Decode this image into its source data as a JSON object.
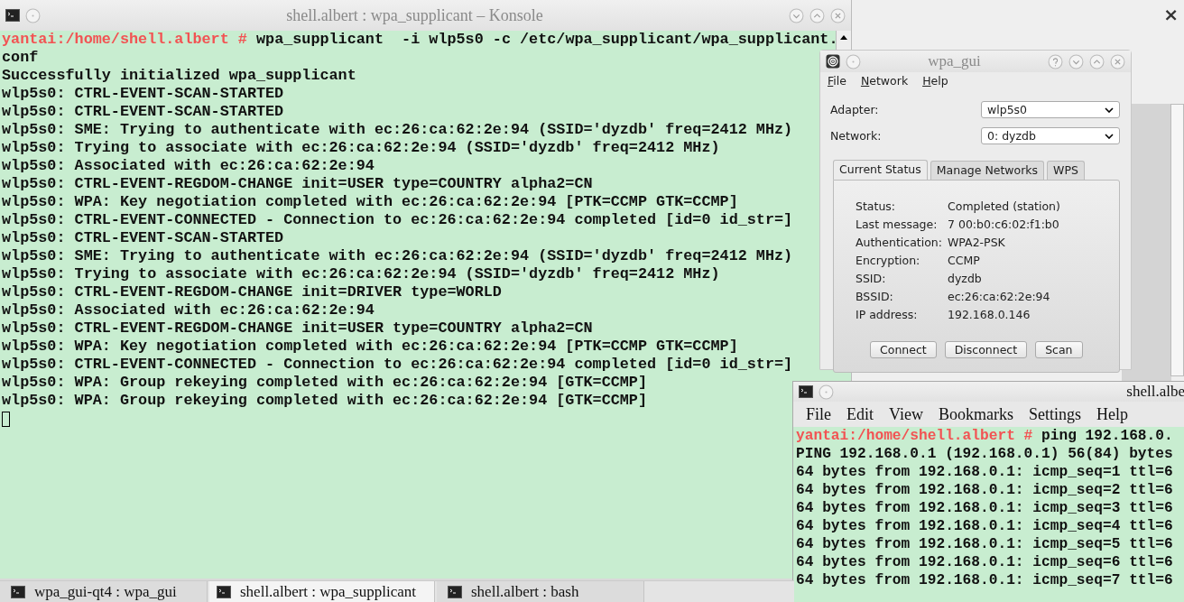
{
  "background_window": {
    "close_button": "×"
  },
  "main_konsole": {
    "title": "shell.albert : wpa_supplicant – Konsole",
    "prompt": "yantai:/home/shell.albert #",
    "command": "wpa_supplicant  -i wlp5s0 -c /etc/wpa_supplicant/wpa_supplicant.",
    "output": [
      "conf",
      "Successfully initialized wpa_supplicant",
      "wlp5s0: CTRL-EVENT-SCAN-STARTED",
      "wlp5s0: CTRL-EVENT-SCAN-STARTED",
      "wlp5s0: SME: Trying to authenticate with ec:26:ca:62:2e:94 (SSID='dyzdb' freq=2412 MHz)",
      "wlp5s0: Trying to associate with ec:26:ca:62:2e:94 (SSID='dyzdb' freq=2412 MHz)",
      "wlp5s0: Associated with ec:26:ca:62:2e:94",
      "wlp5s0: CTRL-EVENT-REGDOM-CHANGE init=USER type=COUNTRY alpha2=CN",
      "wlp5s0: WPA: Key negotiation completed with ec:26:ca:62:2e:94 [PTK=CCMP GTK=CCMP]",
      "wlp5s0: CTRL-EVENT-CONNECTED - Connection to ec:26:ca:62:2e:94 completed [id=0 id_str=]",
      "wlp5s0: CTRL-EVENT-SCAN-STARTED",
      "wlp5s0: SME: Trying to authenticate with ec:26:ca:62:2e:94 (SSID='dyzdb' freq=2412 MHz)",
      "wlp5s0: Trying to associate with ec:26:ca:62:2e:94 (SSID='dyzdb' freq=2412 MHz)",
      "wlp5s0: CTRL-EVENT-REGDOM-CHANGE init=DRIVER type=WORLD",
      "wlp5s0: Associated with ec:26:ca:62:2e:94",
      "wlp5s0: CTRL-EVENT-REGDOM-CHANGE init=USER type=COUNTRY alpha2=CN",
      "wlp5s0: WPA: Key negotiation completed with ec:26:ca:62:2e:94 [PTK=CCMP GTK=CCMP]",
      "wlp5s0: CTRL-EVENT-CONNECTED - Connection to ec:26:ca:62:2e:94 completed [id=0 id_str=]",
      "wlp5s0: WPA: Group rekeying completed with ec:26:ca:62:2e:94 [GTK=CCMP]",
      "wlp5s0: WPA: Group rekeying completed with ec:26:ca:62:2e:94 [GTK=CCMP]"
    ]
  },
  "wpa_gui": {
    "title": "wpa_gui",
    "menu": [
      "File",
      "Network",
      "Help"
    ],
    "fields": [
      {
        "label": "Adapter:",
        "value": "wlp5s0"
      },
      {
        "label": "Network:",
        "value": "0: dyzdb"
      }
    ],
    "tabs": [
      {
        "label": "Current Status",
        "selected": true
      },
      {
        "label": "Manage Networks",
        "selected": false
      },
      {
        "label": "WPS",
        "selected": false
      }
    ],
    "status": [
      {
        "label": "Status:",
        "value": "Completed (station)"
      },
      {
        "label": "Last message:",
        "value": "7 00:b0:c6:02:f1:b0"
      },
      {
        "label": "Authentication:",
        "value": "WPA2-PSK"
      },
      {
        "label": "Encryption:",
        "value": "CCMP"
      },
      {
        "label": "SSID:",
        "value": "dyzdb"
      },
      {
        "label": "BSSID:",
        "value": "ec:26:ca:62:2e:94"
      },
      {
        "label": "IP address:",
        "value": "192.168.0.146"
      }
    ],
    "buttons": [
      "Connect",
      "Disconnect",
      "Scan"
    ]
  },
  "small_konsole": {
    "title": "shell.albe",
    "menu": [
      "File",
      "Edit",
      "View",
      "Bookmarks",
      "Settings",
      "Help"
    ],
    "prompt": "yantai:/home/shell.albert #",
    "command": "ping 192.168.0.",
    "output": [
      "PING 192.168.0.1 (192.168.0.1) 56(84) bytes",
      "64 bytes from 192.168.0.1: icmp_seq=1 ttl=6",
      "64 bytes from 192.168.0.1: icmp_seq=2 ttl=6",
      "64 bytes from 192.168.0.1: icmp_seq=3 ttl=6",
      "64 bytes from 192.168.0.1: icmp_seq=4 ttl=6",
      "64 bytes from 192.168.0.1: icmp_seq=5 ttl=6",
      "64 bytes from 192.168.0.1: icmp_seq=6 ttl=6",
      "64 bytes from 192.168.0.1: icmp_seq=7 ttl=6"
    ]
  },
  "taskbar": [
    {
      "label": "wpa_gui-qt4 : wpa_gui",
      "selected": false
    },
    {
      "label": "shell.albert : wpa_supplicant",
      "selected": true
    },
    {
      "label": "shell.albert : bash",
      "selected": false
    }
  ]
}
